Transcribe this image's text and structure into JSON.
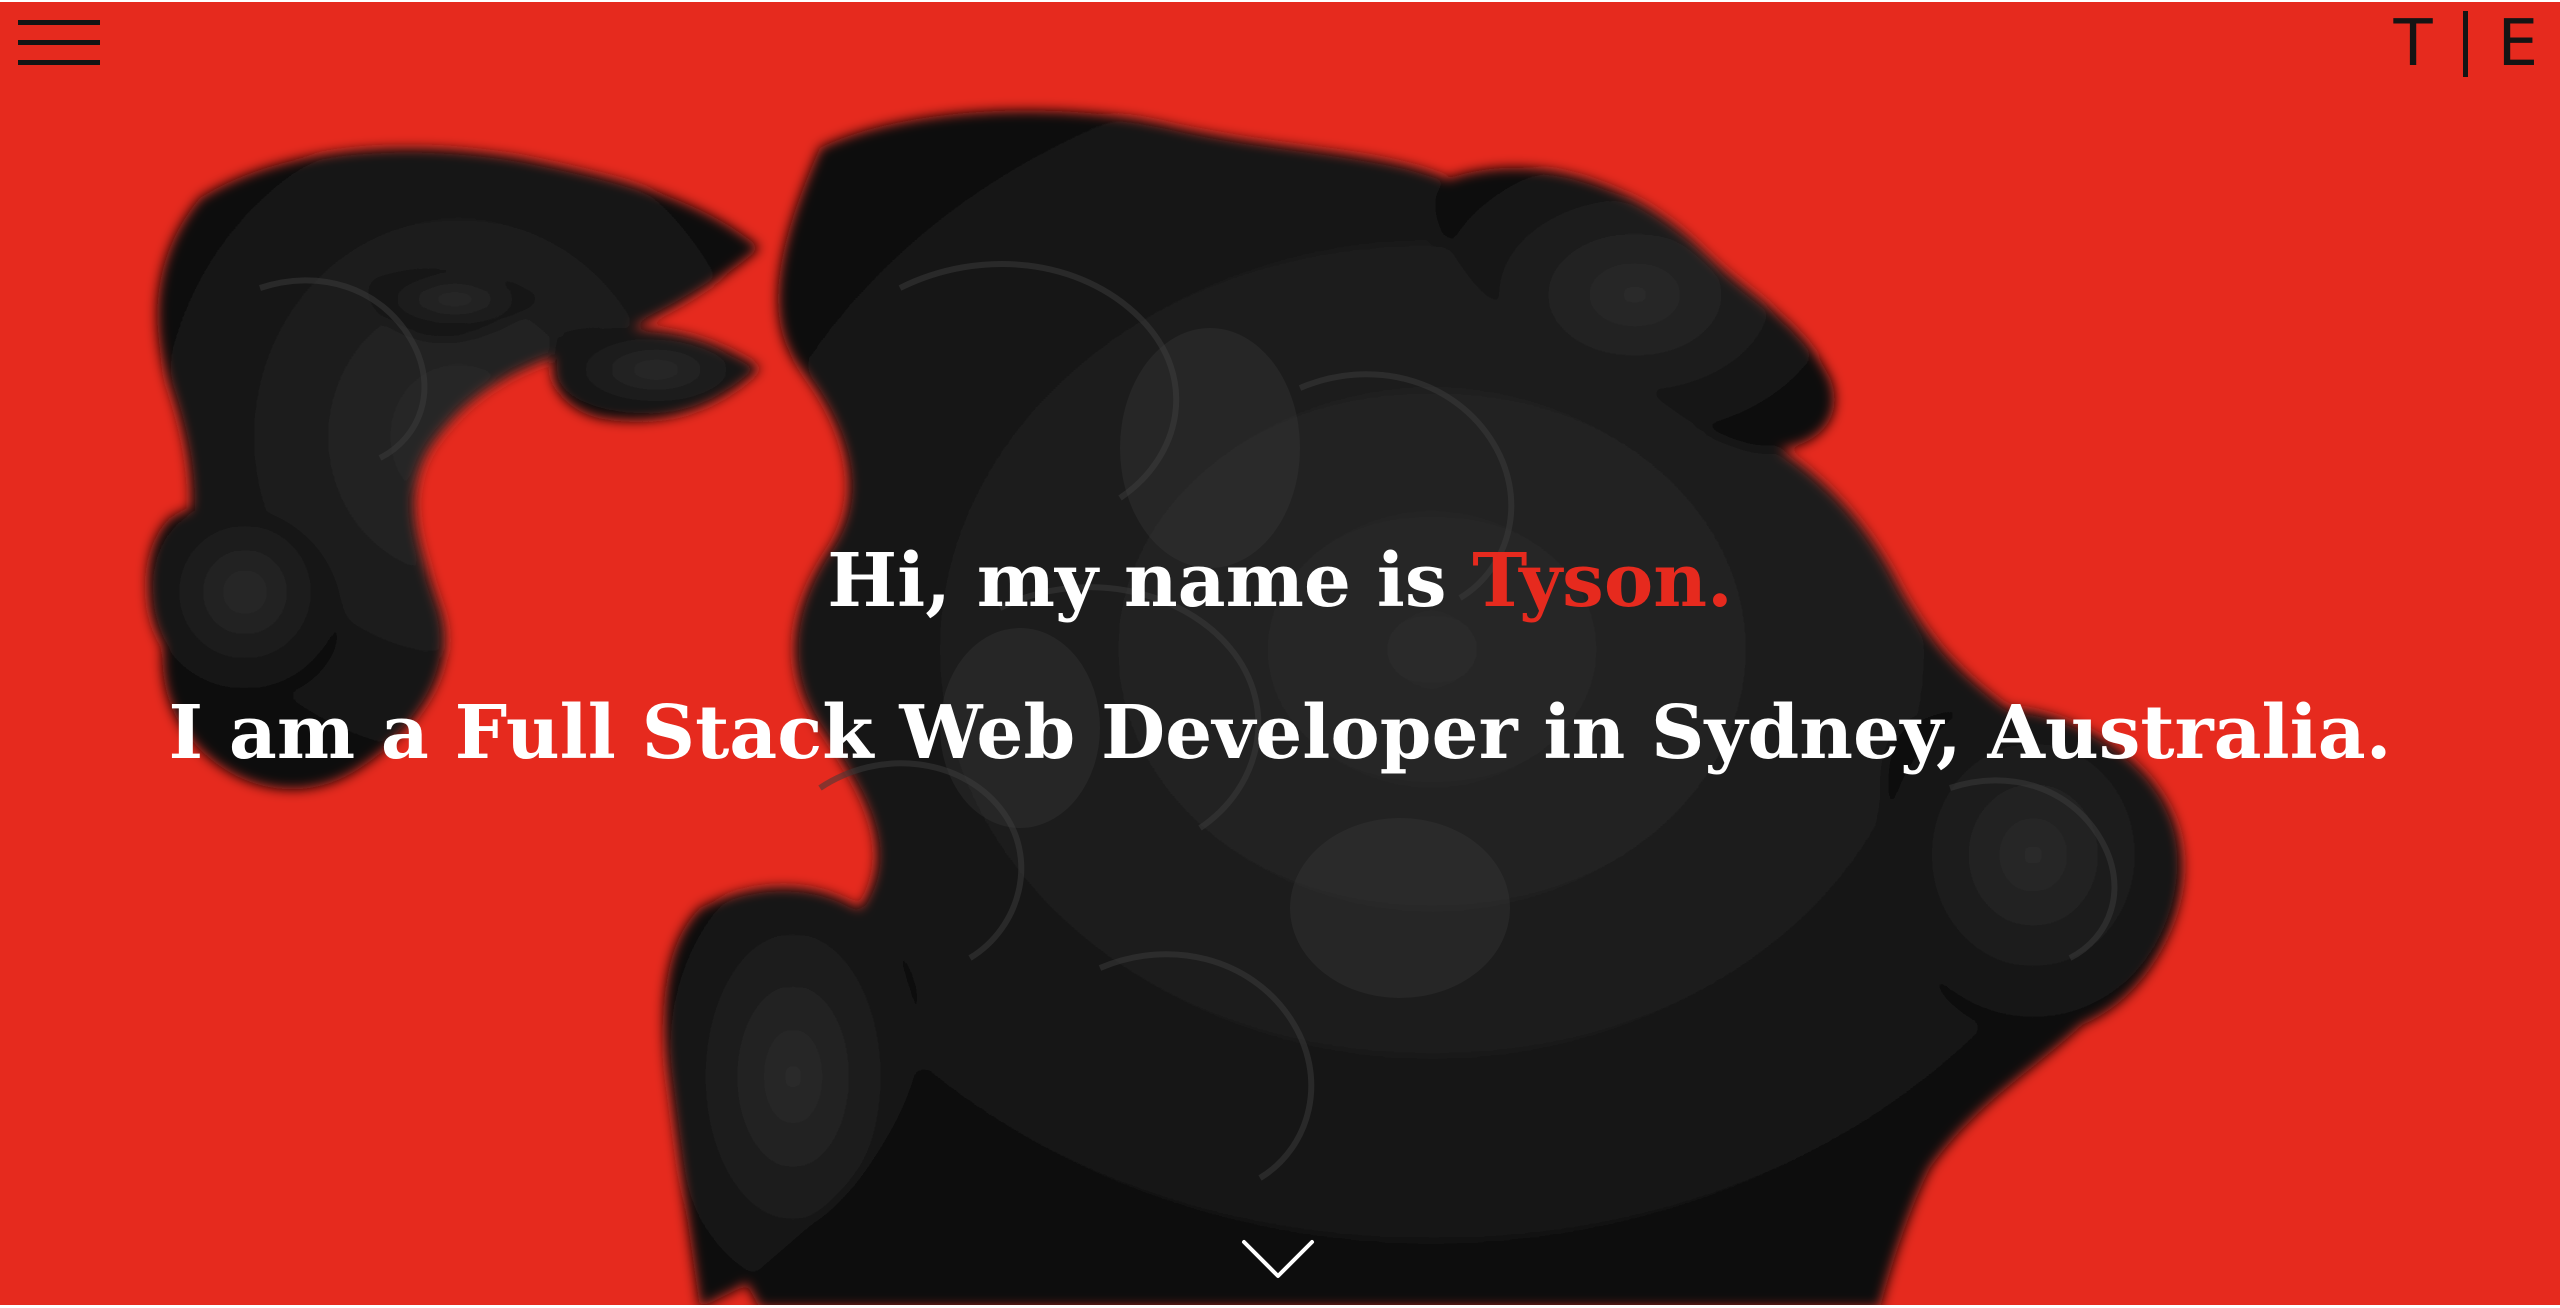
{
  "header": {
    "menu_icon": "hamburger-menu-icon",
    "logo_left": "T",
    "logo_right": "E"
  },
  "hero": {
    "greeting_prefix": "Hi, my name is",
    "greeting_name": "Tyson.",
    "tagline": "I am a Full Stack Web Developer in Sydney, Australia.",
    "scroll_icon": "chevron-down-icon",
    "background_image": "black-ink-smoke-cloud"
  },
  "colors": {
    "accent": "#e62a1e",
    "text": "#ffffff",
    "ink": "#141414"
  }
}
